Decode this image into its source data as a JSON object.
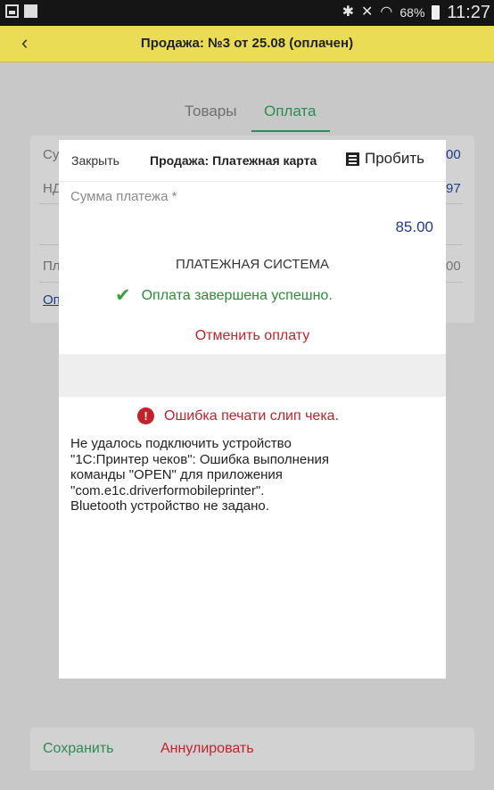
{
  "statusbar": {
    "battery": "68%",
    "time": "11:27"
  },
  "header": {
    "back_icon": "chevron-left-icon",
    "title": "Продажа: №3 от 25.08 (оплачен)"
  },
  "tabs": [
    {
      "label": "Товары"
    },
    {
      "label": "Оплата"
    }
  ],
  "background": {
    "left_fragments": [
      "Су",
      "НД",
      "Пл",
      "Оп"
    ],
    "right_fragments": [
      "00",
      "97",
      "00"
    ]
  },
  "dialog": {
    "close_label": "Закрыть",
    "title": "Продажа: Платежная карта",
    "print_label": "Пробить",
    "payment_amount_label": "Сумма платежа *",
    "payment_amount": "85.00",
    "payment_system": "ПЛАТЕЖНАЯ СИСТЕМА",
    "success_text": "Оплата завершена успешно.",
    "cancel_payment_label": "Отменить оплату",
    "error_title": "Ошибка печати слип чека.",
    "error_lines": [
      "Не удалось подключить устройство",
      "\"1С:Принтер чеков\": Ошибка выполнения",
      "команды \"OPEN\" для приложения",
      "\"com.e1c.driverformobileprinter\".",
      "Bluetooth устройство не задано."
    ]
  },
  "footer": {
    "save_label": "Сохранить",
    "annul_label": "Аннулировать"
  },
  "colors": {
    "accent_green": "#2f8a54",
    "error_red": "#c0232b",
    "header_yellow": "#eadc55",
    "link_blue": "#213a8a"
  }
}
